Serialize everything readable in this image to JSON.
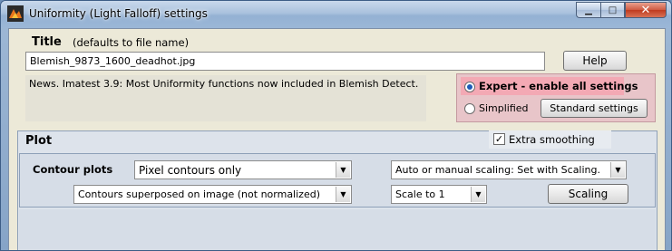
{
  "window": {
    "title": "Uniformity (Light Falloff) settings",
    "controls": {
      "minimize": "▁",
      "maximize": "□",
      "close": "✕"
    }
  },
  "title_section": {
    "label": "Title",
    "hint": "(defaults to file name)",
    "value": "Blemish_9873_1600_deadhot.jpg"
  },
  "help_button": "Help",
  "news": "News. Imatest 3.9:  Most Uniformity functions now included in Blemish Detect.",
  "mode": {
    "expert_label": "Expert - enable all settings",
    "expert_selected": true,
    "simplified_label": "Simplified",
    "standard_settings_button": "Standard settings"
  },
  "plot": {
    "header": "Plot",
    "contour_plots_label": "Contour plots",
    "contour_type": "Pixel contours only",
    "scaling_mode": "Auto or manual scaling: Set with Scaling.",
    "contour_display": "Contours superposed on image (not normalized)",
    "scale": "Scale to 1",
    "scaling_button": "Scaling",
    "extra_smoothing_label": "Extra smoothing",
    "extra_smoothing_checked": true,
    "check_mark": "✓",
    "dropdown_arrow": "▼"
  },
  "colors": {
    "expert_highlight": "#f3a9b4",
    "mode_panel": "#e8c5c9",
    "client_bg": "#ece9d8",
    "plot_bg": "#dde3eb"
  }
}
